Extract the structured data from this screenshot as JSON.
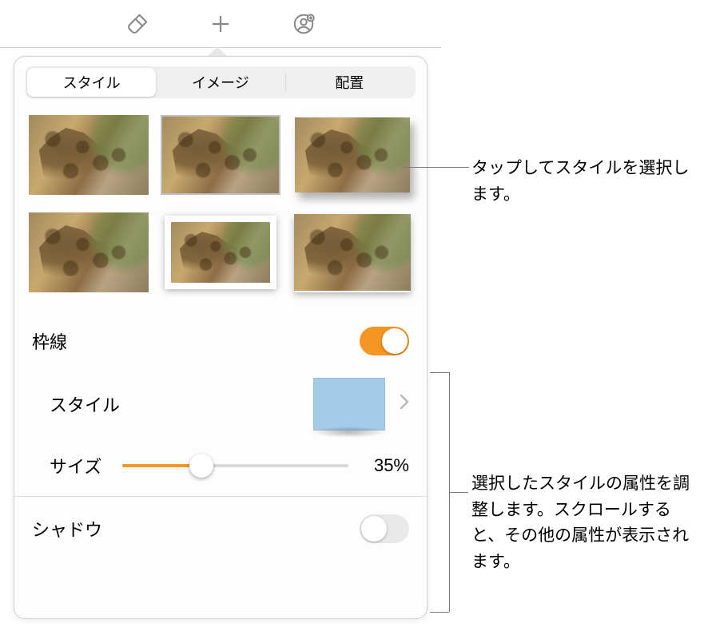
{
  "toolbar": {
    "icons": [
      "brush-icon",
      "plus-icon",
      "collaborate-icon"
    ]
  },
  "tabs": {
    "items": [
      {
        "label": "スタイル",
        "selected": true
      },
      {
        "label": "イメージ",
        "selected": false
      },
      {
        "label": "配置",
        "selected": false
      }
    ]
  },
  "styleGrid": {
    "count": 6
  },
  "border": {
    "label": "枠線",
    "enabled": true,
    "style": {
      "label": "スタイル"
    },
    "size": {
      "label": "サイズ",
      "value": 35,
      "display": "35%"
    }
  },
  "shadow": {
    "label": "シャドウ",
    "enabled": false
  },
  "callouts": {
    "selectStyle": "タップしてスタイルを選択します。",
    "adjustAttrs": "選択したスタイルの属性を調整します。スクロールすると、その他の属性が表示されます。"
  },
  "colors": {
    "accent": "#f59522"
  }
}
